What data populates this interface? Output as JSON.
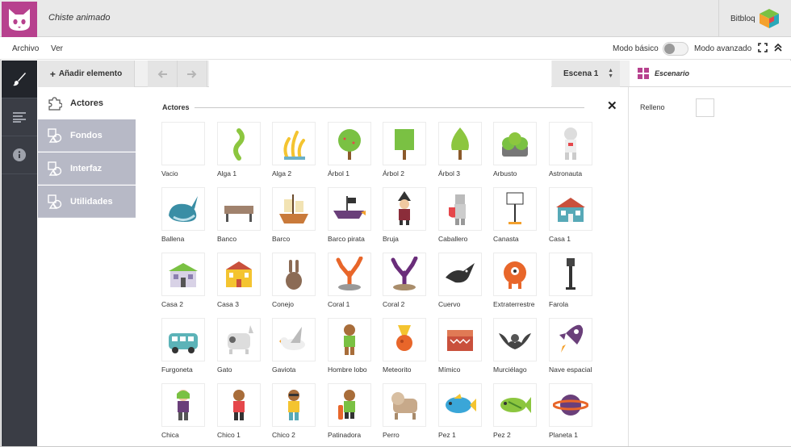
{
  "header": {
    "app_title": "Chiste animado",
    "brand": "Bitbloq"
  },
  "menu": {
    "archivo": "Archivo",
    "ver": "Ver",
    "mode_basic": "Modo básico",
    "mode_advanced": "Modo avanzado"
  },
  "toolbar": {
    "add_label": "Añadir elemento",
    "scene": "Escena 1"
  },
  "categories": [
    {
      "label": "Actores"
    },
    {
      "label": "Fondos"
    },
    {
      "label": "Interfaz"
    },
    {
      "label": "Utilidades"
    }
  ],
  "section": {
    "title": "Actores"
  },
  "actors": [
    {
      "label": "Vacio",
      "icon": "empty"
    },
    {
      "label": "Alga 1",
      "icon": "seaweed"
    },
    {
      "label": "Alga 2",
      "icon": "seaweed-yellow"
    },
    {
      "label": "Árbol 1",
      "icon": "tree-round"
    },
    {
      "label": "Árbol 2",
      "icon": "tree-square"
    },
    {
      "label": "Árbol 3",
      "icon": "tree-cone"
    },
    {
      "label": "Arbusto",
      "icon": "bush"
    },
    {
      "label": "Astronauta",
      "icon": "astronaut"
    },
    {
      "label": "Ballena",
      "icon": "whale"
    },
    {
      "label": "Banco",
      "icon": "bench"
    },
    {
      "label": "Barco",
      "icon": "ship"
    },
    {
      "label": "Barco pirata",
      "icon": "pirate-ship"
    },
    {
      "label": "Bruja",
      "icon": "witch"
    },
    {
      "label": "Caballero",
      "icon": "knight"
    },
    {
      "label": "Canasta",
      "icon": "basket-hoop"
    },
    {
      "label": "Casa 1",
      "icon": "house"
    },
    {
      "label": "Casa 2",
      "icon": "house-green"
    },
    {
      "label": "Casa 3",
      "icon": "house-yellow"
    },
    {
      "label": "Conejo",
      "icon": "rabbit"
    },
    {
      "label": "Coral 1",
      "icon": "coral-orange"
    },
    {
      "label": "Coral 2",
      "icon": "coral-purple"
    },
    {
      "label": "Cuervo",
      "icon": "crow"
    },
    {
      "label": "Extraterrestre",
      "icon": "alien"
    },
    {
      "label": "Farola",
      "icon": "street-lamp"
    },
    {
      "label": "Furgoneta",
      "icon": "van"
    },
    {
      "label": "Gato",
      "icon": "cat"
    },
    {
      "label": "Gaviota",
      "icon": "seagull"
    },
    {
      "label": "Hombre lobo",
      "icon": "werewolf"
    },
    {
      "label": "Meteorito",
      "icon": "meteor"
    },
    {
      "label": "Mímico",
      "icon": "mimic-chest"
    },
    {
      "label": "Murciélago",
      "icon": "bat"
    },
    {
      "label": "Nave espacial",
      "icon": "rocket"
    },
    {
      "label": "Chica",
      "icon": "girl"
    },
    {
      "label": "Chico 1",
      "icon": "boy"
    },
    {
      "label": "Chico 2",
      "icon": "boy-sunglasses"
    },
    {
      "label": "Patinadora",
      "icon": "skater"
    },
    {
      "label": "Perro",
      "icon": "dog"
    },
    {
      "label": "Pez 1",
      "icon": "fish-blue"
    },
    {
      "label": "Pez 2",
      "icon": "fish-green"
    },
    {
      "label": "Planeta 1",
      "icon": "planet"
    }
  ],
  "right_panel": {
    "title": "Escenario",
    "fill_label": "Relleno"
  },
  "colors": {
    "logo_bg": "#b7418e",
    "sidebar_dark": "#3a3d45",
    "category_inactive": "#b7b9c6"
  }
}
